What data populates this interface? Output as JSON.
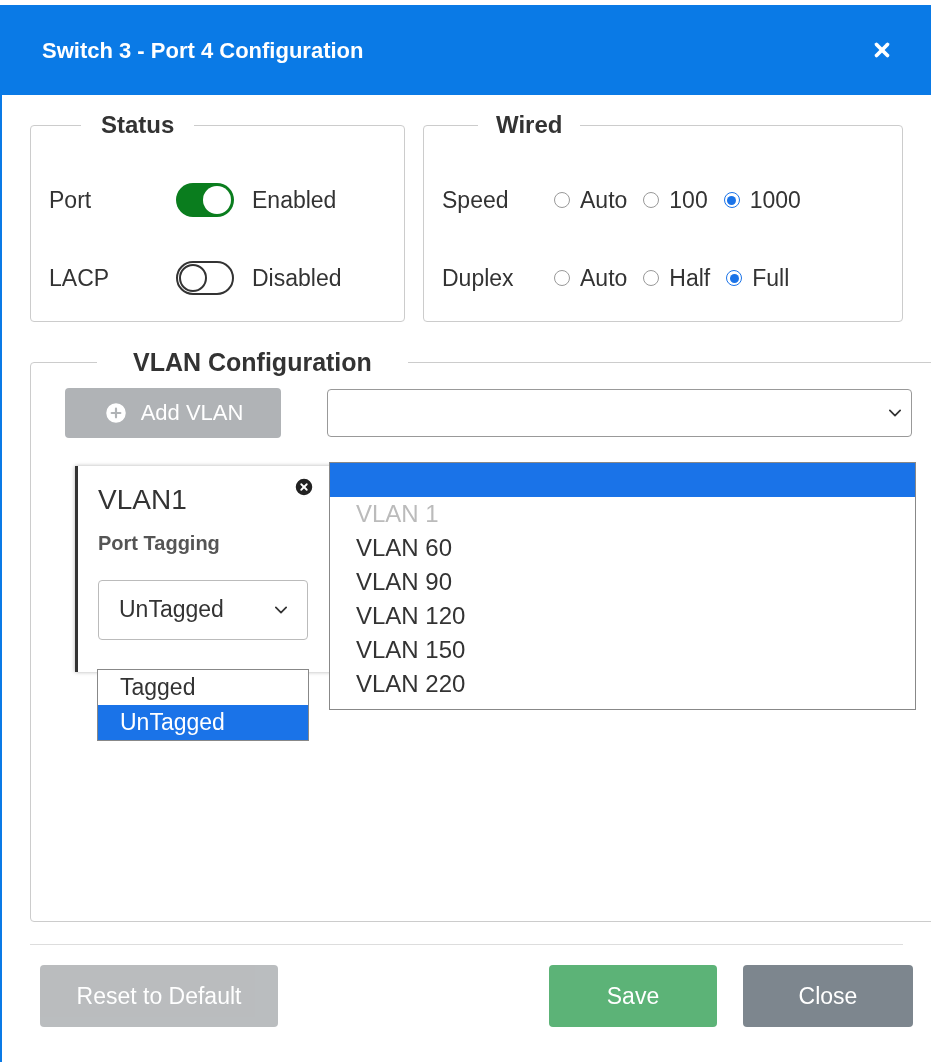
{
  "window": {
    "title": "Switch 3 - Port 4 Configuration"
  },
  "status": {
    "legend": "Status",
    "rows": [
      {
        "label": "Port",
        "on": true,
        "state_text": "Enabled"
      },
      {
        "label": "LACP",
        "on": false,
        "state_text": "Disabled"
      }
    ]
  },
  "wired": {
    "legend": "Wired",
    "groups": [
      {
        "label": "Speed",
        "options": [
          {
            "label": "Auto",
            "selected": false
          },
          {
            "label": "100",
            "selected": false
          },
          {
            "label": "1000",
            "selected": true
          }
        ]
      },
      {
        "label": "Duplex",
        "options": [
          {
            "label": "Auto",
            "selected": false
          },
          {
            "label": "Half",
            "selected": false
          },
          {
            "label": "Full",
            "selected": true
          }
        ]
      }
    ]
  },
  "vlan": {
    "legend": "VLAN Configuration",
    "add_button": {
      "label": "Add VLAN",
      "disabled": true
    },
    "vlan_select": {
      "expanded": true,
      "blank_highlighted": true,
      "options": [
        {
          "label": "VLAN 1",
          "disabled": true
        },
        {
          "label": "VLAN 60",
          "disabled": false
        },
        {
          "label": "VLAN 90",
          "disabled": false
        },
        {
          "label": "VLAN 120",
          "disabled": false
        },
        {
          "label": "VLAN 150",
          "disabled": false
        },
        {
          "label": "VLAN 220",
          "disabled": false
        }
      ]
    },
    "card": {
      "name": "VLAN1",
      "tagging_label": "Port Tagging",
      "tagging_value": "UnTagged",
      "expanded": true,
      "options": [
        {
          "label": "Tagged",
          "selected": false
        },
        {
          "label": "UnTagged",
          "selected": true
        }
      ]
    }
  },
  "footer": {
    "buttons": [
      {
        "label": "Reset to Default",
        "kind": "reset",
        "disabled": true
      },
      {
        "label": "Save",
        "kind": "save",
        "disabled": false
      },
      {
        "label": "Close",
        "kind": "close",
        "disabled": false
      }
    ]
  }
}
